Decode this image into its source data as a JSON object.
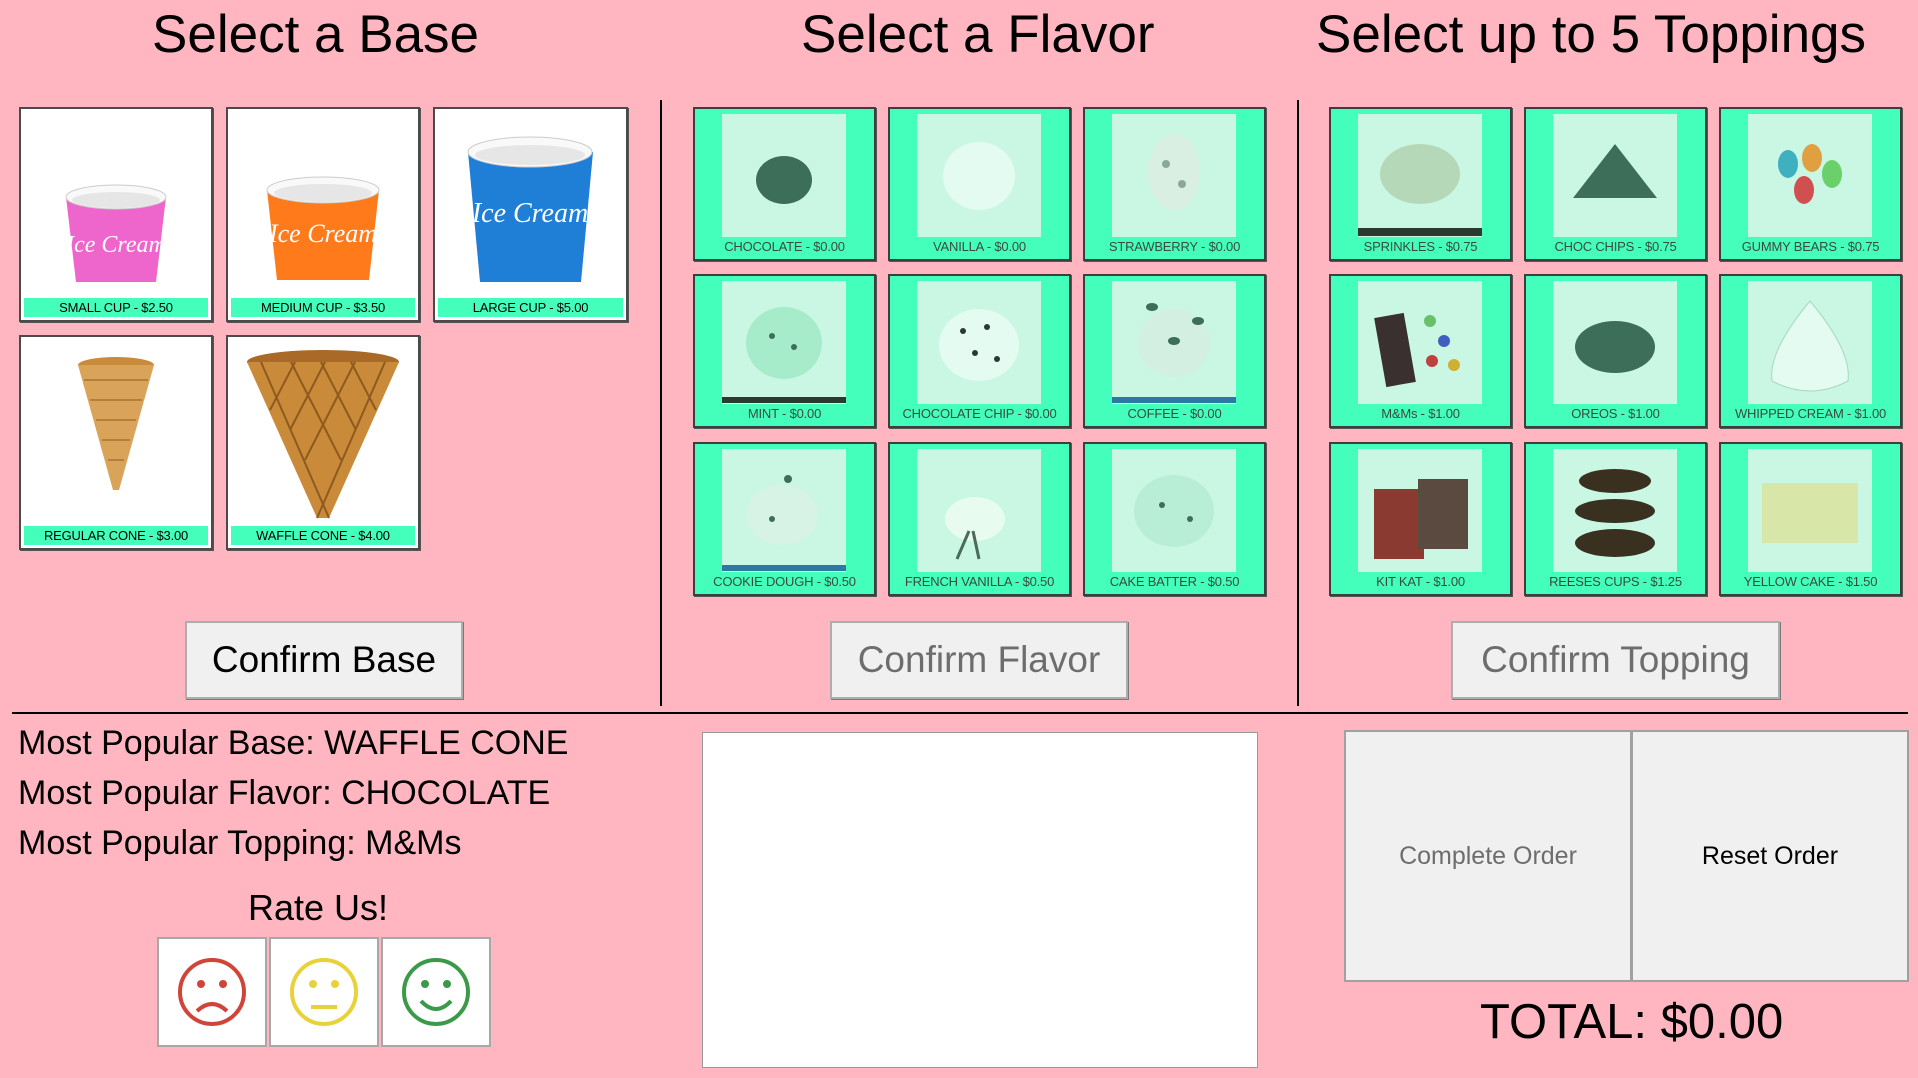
{
  "headers": {
    "base": "Select a Base",
    "flavor": "Select a Flavor",
    "toppings": "Select up to 5 Toppings"
  },
  "bases": [
    {
      "label": "SMALL CUP - $2.50",
      "icon": "small-cup-icon",
      "cup_color": "#ee66cc"
    },
    {
      "label": "MEDIUM CUP - $3.50",
      "icon": "medium-cup-icon",
      "cup_color": "#ff7a1a"
    },
    {
      "label": "LARGE CUP - $5.00",
      "icon": "large-cup-icon",
      "cup_color": "#1f7fd6"
    },
    {
      "label": "REGULAR CONE - $3.00",
      "icon": "regular-cone-icon",
      "cup_color": "#d9a35a"
    },
    {
      "label": "WAFFLE CONE - $4.00",
      "icon": "waffle-cone-icon",
      "cup_color": "#c98a3a"
    }
  ],
  "cup_logo_text": "Ice Cream",
  "flavors": [
    {
      "label": "CHOCOLATE - $0.00",
      "icon": "chocolate-scoop-icon"
    },
    {
      "label": "VANILLA - $0.00",
      "icon": "vanilla-scoop-icon"
    },
    {
      "label": "STRAWBERRY - $0.00",
      "icon": "strawberry-scoop-icon"
    },
    {
      "label": "MINT - $0.00",
      "icon": "mint-scoop-icon"
    },
    {
      "label": "CHOCOLATE CHIP - $0.00",
      "icon": "chocolate-chip-scoop-icon"
    },
    {
      "label": "COFFEE - $0.00",
      "icon": "coffee-scoop-icon"
    },
    {
      "label": "COOKIE DOUGH - $0.50",
      "icon": "cookie-dough-scoop-icon"
    },
    {
      "label": "FRENCH VANILLA - $0.50",
      "icon": "french-vanilla-scoop-icon"
    },
    {
      "label": "CAKE BATTER - $0.50",
      "icon": "cake-batter-scoop-icon"
    }
  ],
  "toppings": [
    {
      "label": "SPRINKLES - $0.75",
      "icon": "sprinkles-icon"
    },
    {
      "label": "CHOC CHIPS - $0.75",
      "icon": "choc-chips-icon"
    },
    {
      "label": "GUMMY BEARS - $0.75",
      "icon": "gummy-bears-icon"
    },
    {
      "label": "M&Ms - $1.00",
      "icon": "mms-icon"
    },
    {
      "label": "OREOS - $1.00",
      "icon": "oreos-icon"
    },
    {
      "label": "WHIPPED CREAM - $1.00",
      "icon": "whipped-cream-icon"
    },
    {
      "label": "KIT KAT - $1.00",
      "icon": "kit-kat-icon"
    },
    {
      "label": "REESES CUPS - $1.25",
      "icon": "reeses-cups-icon"
    },
    {
      "label": "YELLOW CAKE - $1.50",
      "icon": "yellow-cake-icon"
    }
  ],
  "buttons": {
    "confirm_base": "Confirm Base",
    "confirm_flavor": "Confirm Flavor",
    "confirm_topping": "Confirm Topping",
    "complete_order": "Complete Order",
    "reset_order": "Reset Order"
  },
  "stats": {
    "popular_base": "Most Popular Base: WAFFLE CONE",
    "popular_flavor": "Most Popular Flavor: CHOCOLATE",
    "popular_topping": "Most Popular Topping: M&Ms"
  },
  "rating": {
    "title": "Rate Us!",
    "faces": [
      {
        "icon": "sad-face-icon",
        "color": "#d0453a"
      },
      {
        "icon": "neutral-face-icon",
        "color": "#e8d23a"
      },
      {
        "icon": "happy-face-icon",
        "color": "#3a9a4a"
      }
    ]
  },
  "total": "TOTAL: $0.00",
  "colors": {
    "background": "#ffb6c1",
    "tile_accent": "#44ffbb",
    "button_face": "#f0f0f0"
  }
}
